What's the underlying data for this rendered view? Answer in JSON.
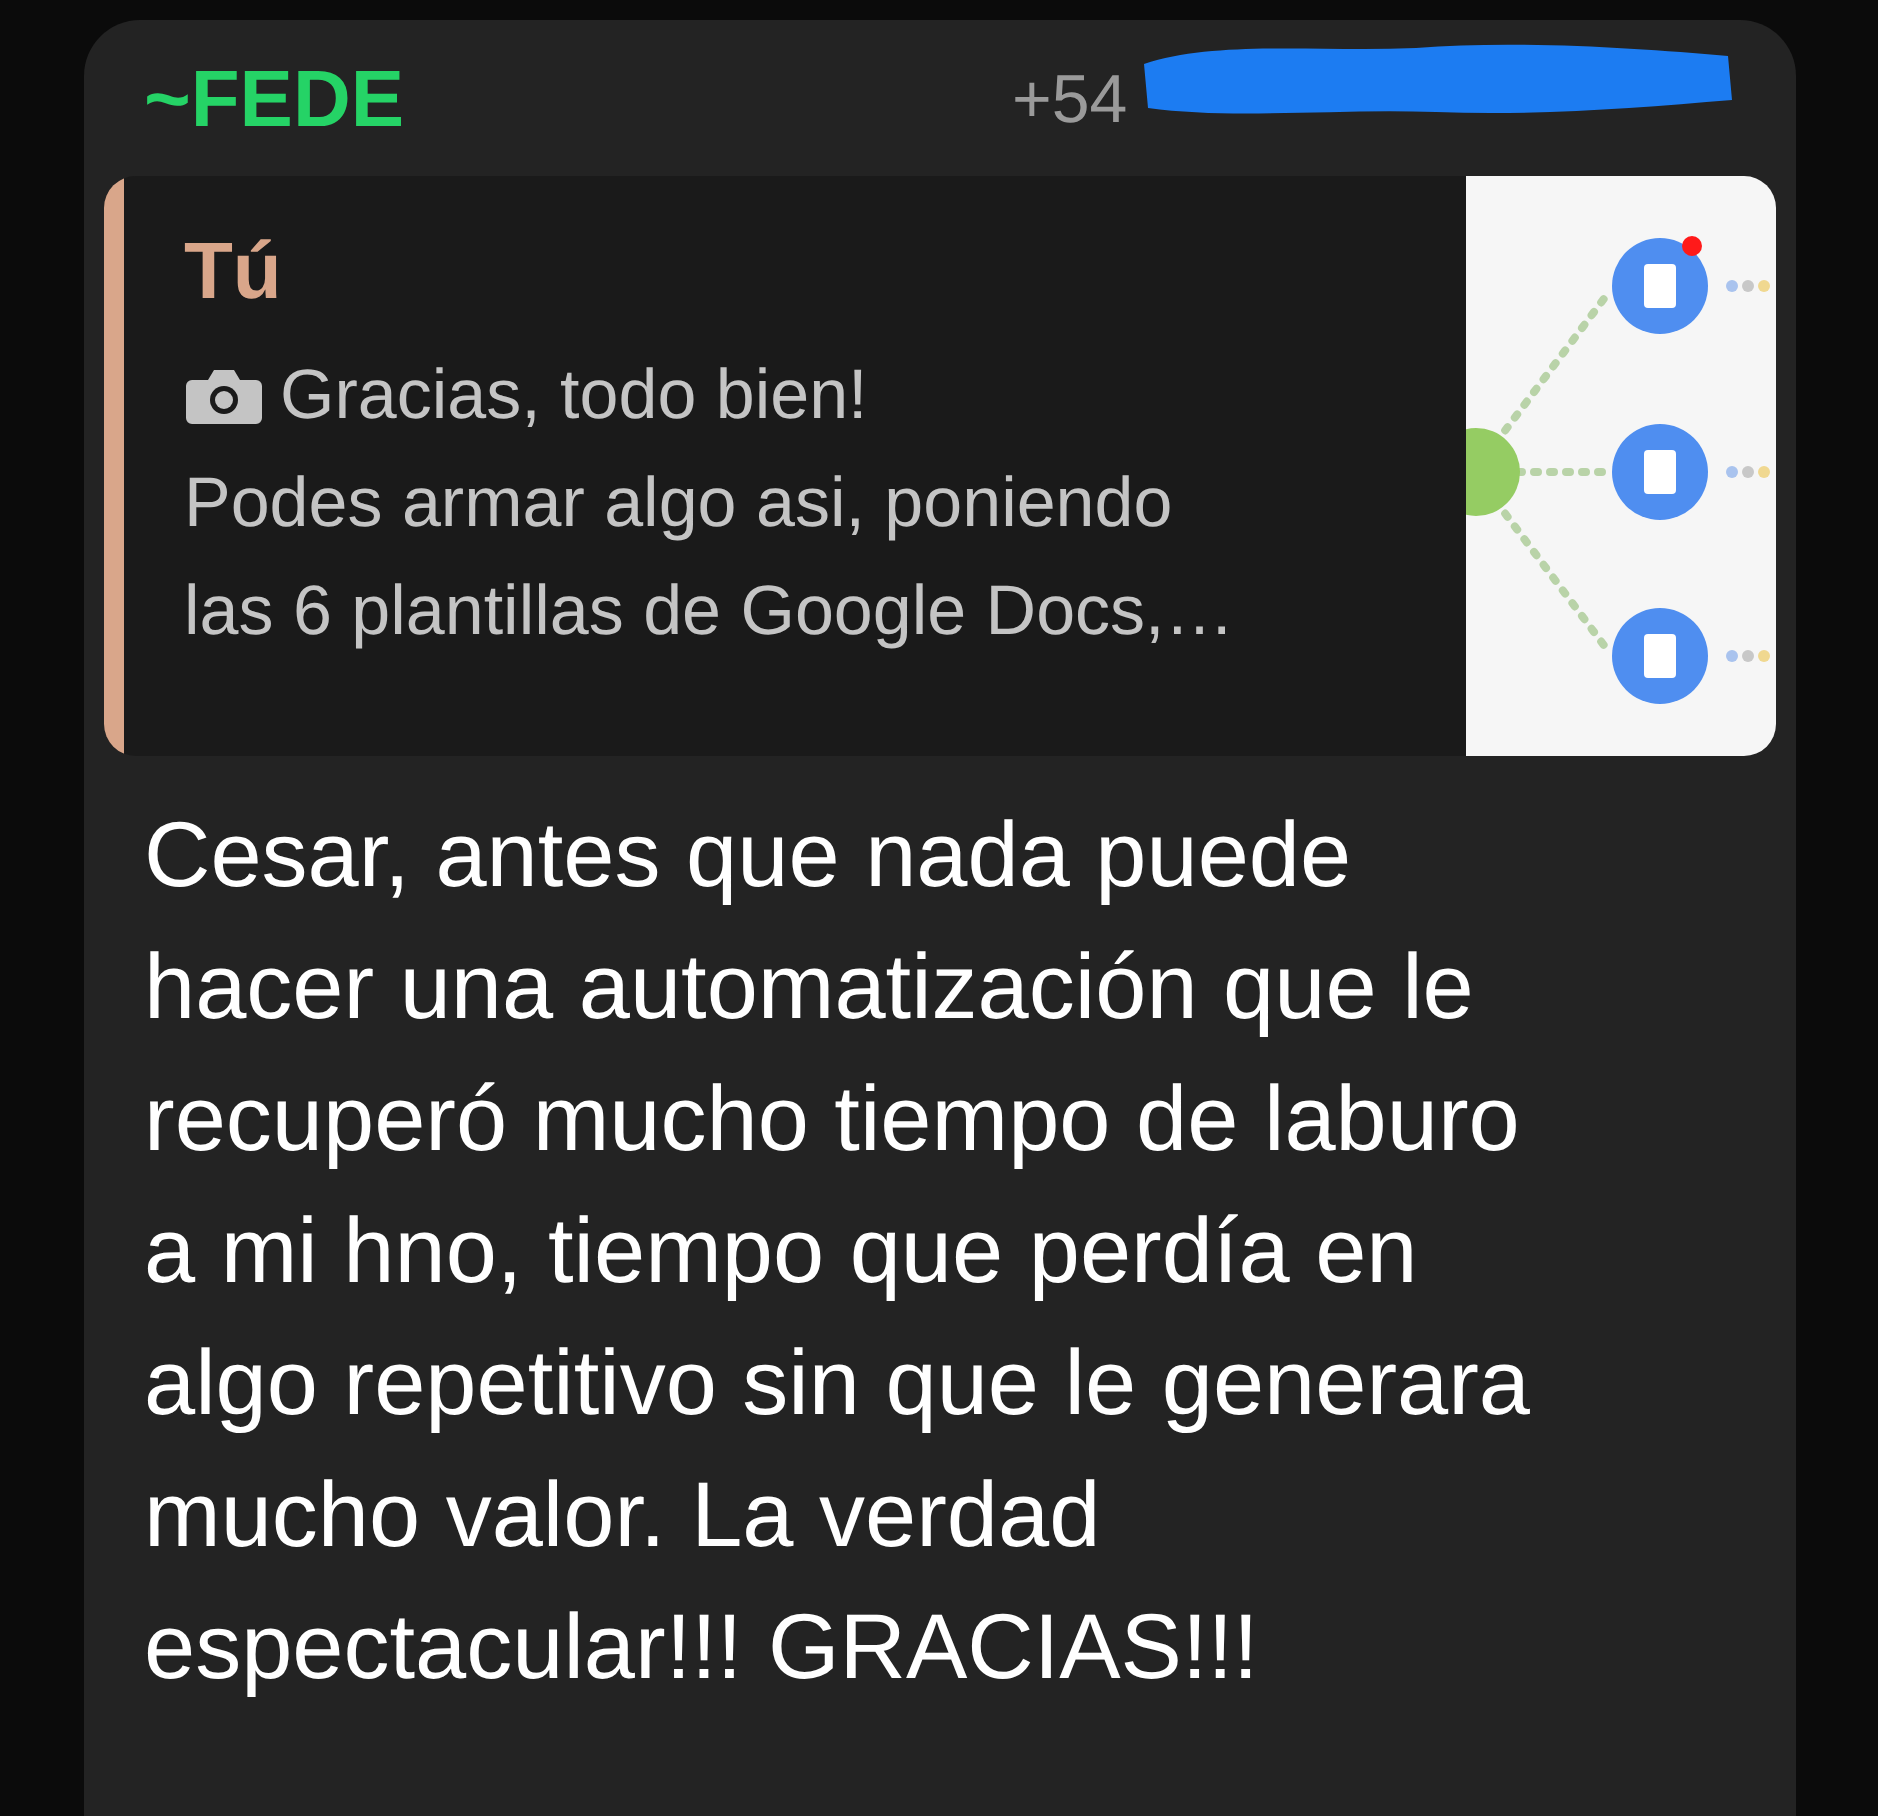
{
  "message": {
    "sender": "~FEDE",
    "phone": "+54",
    "quote": {
      "author": "Tú",
      "lines": [
        "Gracias, todo bien!",
        "Podes armar algo asi, poniendo",
        "las 6 plantillas de Google Docs,…"
      ]
    },
    "body_lines": [
      "Cesar, antes que nada puede",
      "hacer una automatización que le",
      "recuperó mucho tiempo de laburo",
      "a mi hno, tiempo que perdía en",
      "algo repetitivo sin que le generara",
      "mucho valor. La verdad",
      "espectacular!!! GRACIAS!!!"
    ]
  }
}
